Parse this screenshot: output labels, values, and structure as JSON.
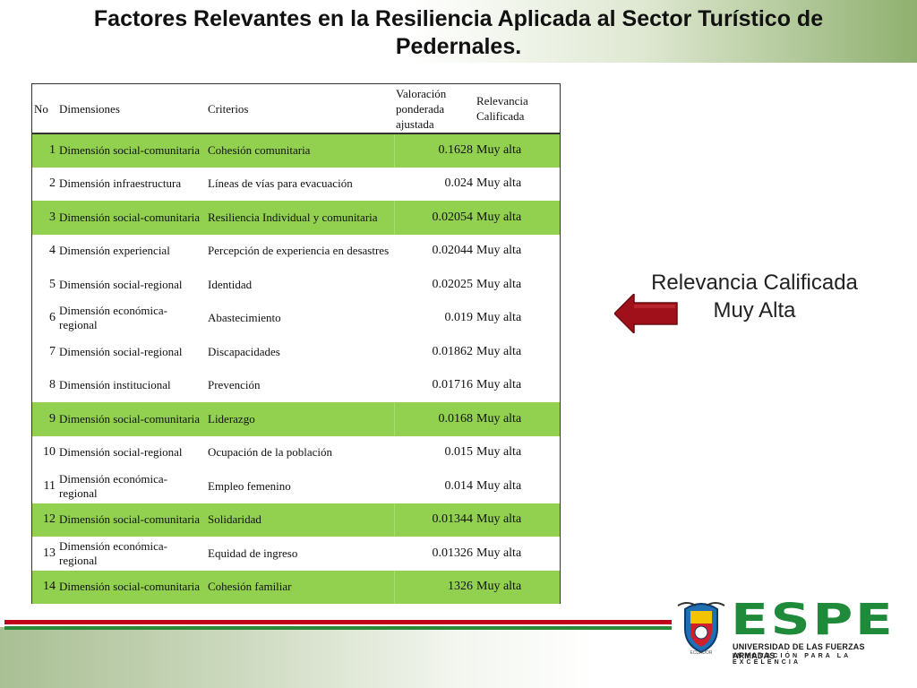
{
  "slide": {
    "title_line1": "Factores Relevantes en la Resiliencia Aplicada al Sector Turístico de",
    "title_line2": "Pedernales."
  },
  "table": {
    "headers": {
      "no": "No",
      "dimensiones": "Dimensiones",
      "criterios": "Criterios",
      "valoracion_l1": "Valoración",
      "valoracion_l2": "ponderada",
      "valoracion_l3": "ajustada",
      "relevancia_l1": "Relevancia",
      "relevancia_l2": "Calificada"
    },
    "highlight_color": "#92d050",
    "rows": [
      {
        "no": "1",
        "dimension": "Dimensión social-comunitaria",
        "criterio": "Cohesión comunitaria",
        "valor": "0.1628",
        "relevancia": "Muy alta",
        "highlight": true
      },
      {
        "no": "2",
        "dimension": "Dimensión infraestructura",
        "criterio": "Líneas de vías para evacuación",
        "valor": "0.024",
        "relevancia": "Muy alta",
        "highlight": false
      },
      {
        "no": "3",
        "dimension": "Dimensión social-comunitaria",
        "criterio": "Resiliencia Individual y comunitaria",
        "valor": "0.02054",
        "relevancia": "Muy alta",
        "highlight": true
      },
      {
        "no": "4",
        "dimension": "Dimensión experiencial",
        "criterio": "Percepción de experiencia en desastres",
        "valor": "0.02044",
        "relevancia": "Muy alta",
        "highlight": false
      },
      {
        "no": "5",
        "dimension": "Dimensión social-regional",
        "criterio": "Identidad",
        "valor": "0.02025",
        "relevancia": "Muy alta",
        "highlight": false
      },
      {
        "no": "6",
        "dimension": "Dimensión económica-regional",
        "criterio": "Abastecimiento",
        "valor": "0.019",
        "relevancia": "Muy alta",
        "highlight": false
      },
      {
        "no": "7",
        "dimension": "Dimensión social-regional",
        "criterio": "Discapacidades",
        "valor": "0.01862",
        "relevancia": "Muy alta",
        "highlight": false
      },
      {
        "no": "8",
        "dimension": "Dimensión institucional",
        "criterio": "Prevención",
        "valor": "0.01716",
        "relevancia": "Muy alta",
        "highlight": false
      },
      {
        "no": "9",
        "dimension": "Dimensión social-comunitaria",
        "criterio": "Liderazgo",
        "valor": "0.0168",
        "relevancia": "Muy alta",
        "highlight": true
      },
      {
        "no": "10",
        "dimension": "Dimensión social-regional",
        "criterio": "Ocupación de la población",
        "valor": "0.015",
        "relevancia": "Muy alta",
        "highlight": false
      },
      {
        "no": "11",
        "dimension": "Dimensión económica-regional",
        "criterio": "Empleo femenino",
        "valor": "0.014",
        "relevancia": "Muy alta",
        "highlight": false
      },
      {
        "no": "12",
        "dimension": "Dimensión social-comunitaria",
        "criterio": "Solidaridad",
        "valor": "0.01344",
        "relevancia": "Muy alta",
        "highlight": true
      },
      {
        "no": "13",
        "dimension": "Dimensión económica-regional",
        "criterio": "Equidad de ingreso",
        "valor": "0.01326",
        "relevancia": "Muy alta",
        "highlight": false
      },
      {
        "no": "14",
        "dimension": "Dimensión social-comunitaria",
        "criterio": "Cohesión familiar",
        "valor": "1326",
        "relevancia": "Muy alta",
        "highlight": true
      }
    ]
  },
  "callout": {
    "line1": "Relevancia Calificada",
    "line2": "Muy Alta",
    "arrow_icon": "left-arrow-icon",
    "arrow_color": "#a0101a"
  },
  "footer": {
    "crest_label": "ECUADOR",
    "logo_text": "ESPE",
    "logo_subtitle": "UNIVERSIDAD DE LAS FUERZAS ARMADAS",
    "logo_tagline": "INNOVACIÓN PARA LA EXCELENCIA",
    "brand_green": "#1f8a3a",
    "stripe_red": "#c0001a"
  }
}
